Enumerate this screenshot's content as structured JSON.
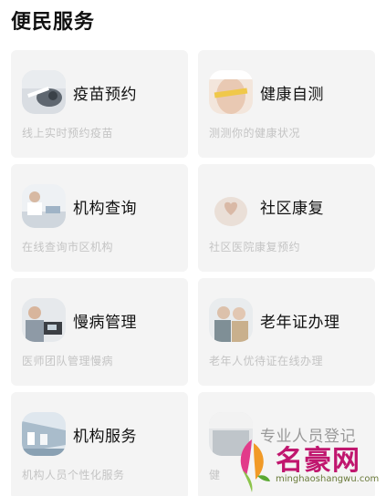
{
  "section": {
    "title": "便民服务"
  },
  "services": [
    {
      "label": "疫苗预约",
      "desc": "线上实时预约疫苗",
      "icon": "vaccine-photo-icon"
    },
    {
      "label": "健康自测",
      "desc": "测测你的健康状况",
      "icon": "waist-measure-photo-icon"
    },
    {
      "label": "机构查询",
      "desc": "在线查询市区机构",
      "icon": "doctor-desk-photo-icon"
    },
    {
      "label": "社区康复",
      "desc": "社区医院康复预约",
      "icon": "heart-hands-photo-icon"
    },
    {
      "label": "慢病管理",
      "desc": "医师团队管理慢病",
      "icon": "blood-pressure-photo-icon"
    },
    {
      "label": "老年证办理",
      "desc": "老年人优待证在线办理",
      "icon": "elderly-couple-photo-icon"
    },
    {
      "label": "机构服务",
      "desc": "机构人员个性化服务",
      "icon": "hospital-corridor-photo-icon"
    },
    {
      "label": "专业人员登记",
      "desc": "健",
      "icon": "staff-photo-icon"
    }
  ],
  "watermark": {
    "brand": "名豪网",
    "url": "minghaoshangwu.com"
  },
  "colors": {
    "card_bg": "#f4f4f4",
    "desc_text": "#c4c4c4",
    "watermark": "#c0166e"
  }
}
